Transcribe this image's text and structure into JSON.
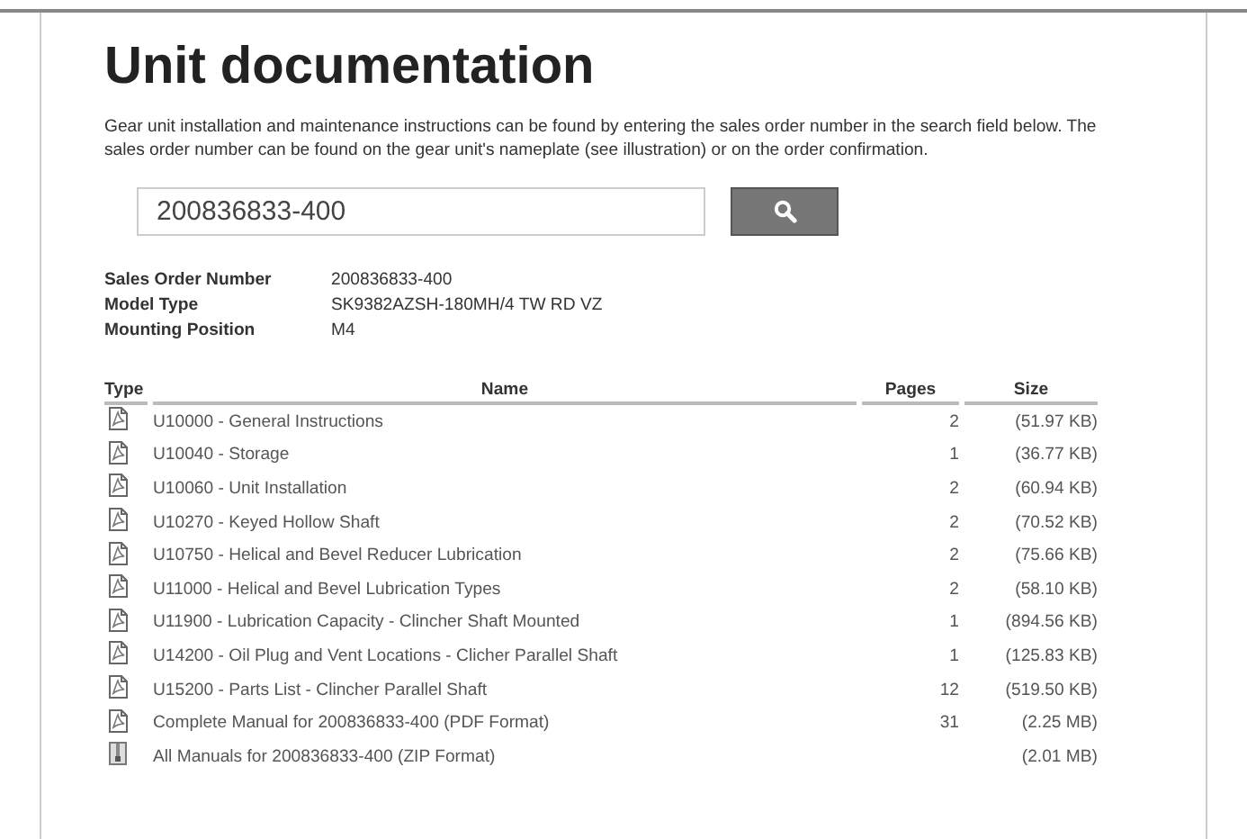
{
  "title": "Unit documentation",
  "intro": "Gear unit installation and maintenance instructions can be found by entering the sales order number in the search field below. The sales order number can be found on the gear unit's nameplate (see illustration) or on the order confirmation.",
  "search": {
    "value": "200836833-400"
  },
  "details": [
    {
      "label": "Sales Order Number",
      "value": "200836833-400"
    },
    {
      "label": "Model Type",
      "value": "SK9382AZSH-180MH/4 TW RD VZ"
    },
    {
      "label": "Mounting Position",
      "value": "M4"
    }
  ],
  "table": {
    "columns": [
      "Type",
      "Name",
      "Pages",
      "Size"
    ],
    "rows": [
      {
        "kind": "pdf",
        "name": "U10000 - General Instructions",
        "pages": "2",
        "size": "(51.97 KB)"
      },
      {
        "kind": "pdf",
        "name": "U10040 - Storage",
        "pages": "1",
        "size": "(36.77 KB)"
      },
      {
        "kind": "pdf",
        "name": "U10060 - Unit Installation",
        "pages": "2",
        "size": "(60.94 KB)"
      },
      {
        "kind": "pdf",
        "name": "U10270 - Keyed Hollow Shaft",
        "pages": "2",
        "size": "(70.52 KB)"
      },
      {
        "kind": "pdf",
        "name": "U10750 - Helical and Bevel Reducer Lubrication",
        "pages": "2",
        "size": "(75.66 KB)"
      },
      {
        "kind": "pdf",
        "name": "U11000 - Helical and Bevel Lubrication Types",
        "pages": "2",
        "size": "(58.10 KB)"
      },
      {
        "kind": "pdf",
        "name": "U11900 - Lubrication Capacity - Clincher Shaft Mounted",
        "pages": "1",
        "size": "(894.56 KB)"
      },
      {
        "kind": "pdf",
        "name": "U14200 - Oil Plug and Vent Locations - Clicher Parallel Shaft",
        "pages": "1",
        "size": "(125.83 KB)"
      },
      {
        "kind": "pdf",
        "name": "U15200 - Parts List - Clincher Parallel Shaft",
        "pages": "12",
        "size": "(519.50 KB)"
      },
      {
        "kind": "pdf",
        "name": "Complete Manual for 200836833-400 (PDF Format)",
        "pages": "31",
        "size": "(2.25 MB)"
      },
      {
        "kind": "zip",
        "name": "All Manuals for 200836833-400 (ZIP Format)",
        "size": "(2.01 MB)"
      }
    ]
  }
}
